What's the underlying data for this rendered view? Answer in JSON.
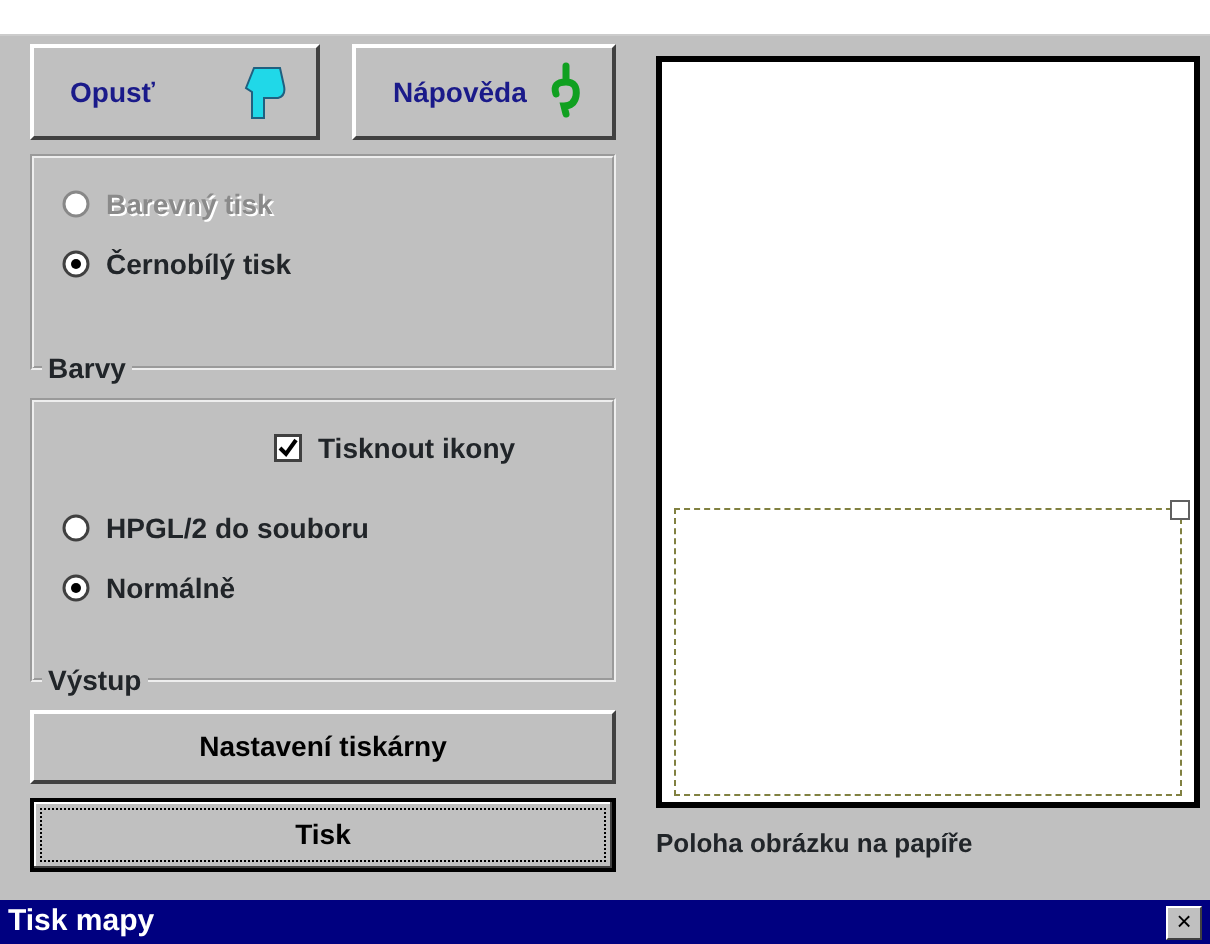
{
  "bottom_buttons": [
    {
      "label": "Opusť"
    },
    {
      "label": "Nápověda"
    }
  ],
  "groups": [
    {
      "legend": "Barvy",
      "items": [
        {
          "kind": "radio",
          "label": "Barevný tisk",
          "selected": false,
          "disabled": true
        },
        {
          "kind": "radio",
          "label": "Černobílý tisk",
          "selected": true,
          "disabled": false
        }
      ]
    },
    {
      "legend": "Výstup",
      "items": [
        {
          "kind": "checkbox",
          "label": "Tisknout ikony",
          "checked": true
        },
        {
          "kind": "radio",
          "label": "HPGL/2 do souboru",
          "selected": false,
          "disabled": false
        },
        {
          "kind": "radio",
          "label": "Normálně",
          "selected": true,
          "disabled": false
        }
      ]
    }
  ],
  "buttons": [
    {
      "label": "Nastavení tiskárny",
      "focused": false
    },
    {
      "label": "Tisk",
      "focused": true
    }
  ],
  "preview": {
    "label": "Poloha obrázku na papíře"
  },
  "window": {
    "title": "Tisk mapy",
    "close": "×"
  }
}
